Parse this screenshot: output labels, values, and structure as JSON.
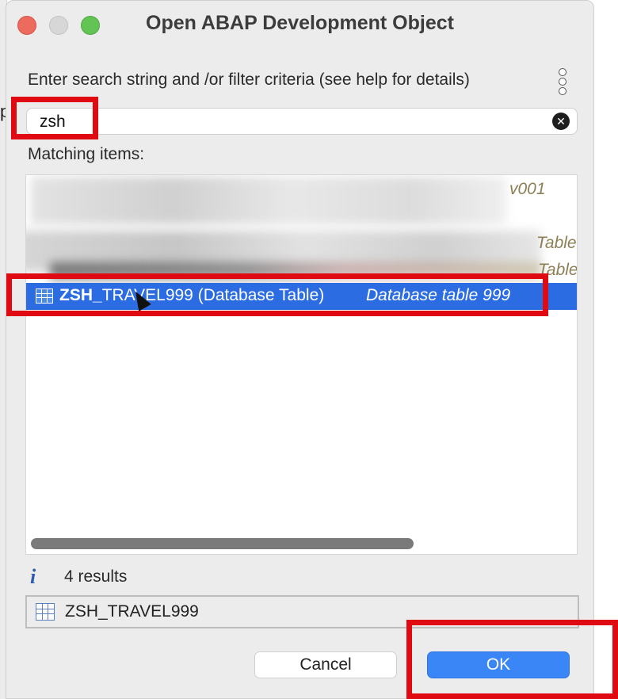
{
  "dialog": {
    "title": "Open ABAP Development Object",
    "instruction": "Enter search string and /or filter criteria (see help for details)",
    "help_icon": "vertical-dots-icon"
  },
  "search": {
    "value": "zsh",
    "placeholder": ""
  },
  "list": {
    "label": "Matching items:",
    "items": [
      {
        "text": "",
        "description": "v001",
        "blurred": true
      },
      {
        "text": "",
        "description": "Table",
        "blurred": true
      },
      {
        "text": "",
        "description": "Table",
        "blurred": true
      },
      {
        "name_bold": "ZSH_",
        "name_rest": "TRAVEL999",
        "type": "(Database Table)",
        "description": "Database table 999",
        "selected": true,
        "icon": "table-icon"
      }
    ]
  },
  "status": {
    "icon": "info-icon",
    "result_count": "4 results"
  },
  "selection": {
    "icon": "table-icon",
    "value": "ZSH_TRAVEL999"
  },
  "buttons": {
    "cancel": "Cancel",
    "ok": "OK"
  },
  "colors": {
    "selection": "#2c6ce3",
    "ok_button": "#3b86f7",
    "annotation": "#e00b12",
    "description": "#8d7f55"
  }
}
